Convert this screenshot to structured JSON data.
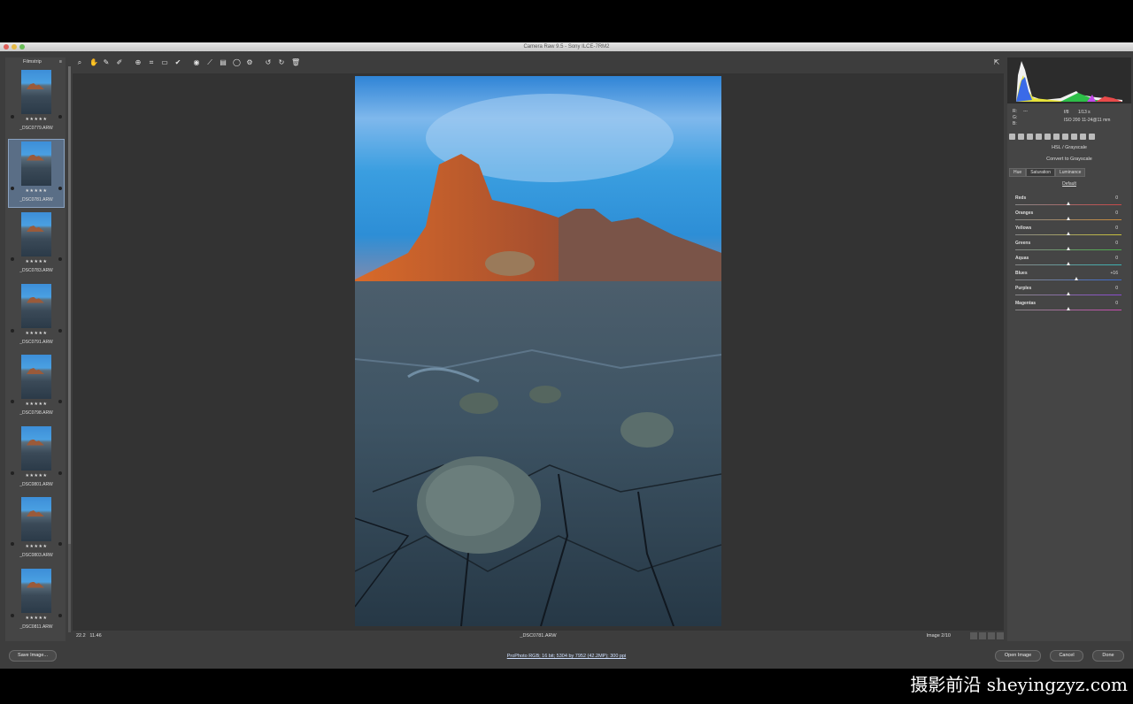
{
  "app": {
    "title": "Camera Raw 9.5 - Sony ILCE-7RM2"
  },
  "filmstrip": {
    "header": "Filmstrip",
    "menu_icon": "≡",
    "items": [
      {
        "name": "_DSC0779.ARW",
        "stars": "★★★★★"
      },
      {
        "name": "_DSC0781.ARW",
        "stars": "★★★★★"
      },
      {
        "name": "_DSC0783.ARW",
        "stars": "★★★★★"
      },
      {
        "name": "_DSC0791.ARW",
        "stars": "★★★★★"
      },
      {
        "name": "_DSC0798.ARW",
        "stars": "★★★★★"
      },
      {
        "name": "_DSC0801.ARW",
        "stars": "★★★★★"
      },
      {
        "name": "_DSC0803.ARW",
        "stars": "★★★★★"
      },
      {
        "name": "_DSC0811.ARW",
        "stars": "★★★★★"
      }
    ],
    "selected_index": 1
  },
  "toolbar": {
    "tools": [
      "zoom-icon",
      "hand-icon",
      "white-balance-icon",
      "color-sampler-icon",
      "targeted-adjust-icon",
      "crop-icon",
      "straighten-icon",
      "spot-removal-icon",
      "red-eye-icon",
      "adjustment-brush-icon",
      "graduated-filter-icon",
      "radial-filter-icon",
      "preferences-icon",
      "rotate-ccw-icon",
      "rotate-cw-icon",
      "trash-icon"
    ],
    "fullscreen_icon": "fullscreen-icon"
  },
  "status": {
    "zoom": "22.2",
    "zoom2": "11.46",
    "filename": "_DSC0781.ARW",
    "image_counter": "Image 2/10"
  },
  "panel": {
    "camera_info": {
      "rgb": [
        "R:",
        "G:",
        "B:"
      ],
      "dashes": "---",
      "aperture": "f/8",
      "shutter": "1/13 s",
      "iso": "ISO 200",
      "lens": "11-24@11 mm"
    },
    "title": "HSL / Grayscale",
    "convert_label": "Convert to Grayscale",
    "subtabs": [
      "Hue",
      "Saturation",
      "Luminance"
    ],
    "active_subtab": "Saturation",
    "default_label": "Default",
    "sliders": [
      {
        "label": "Reds",
        "value": "0",
        "pos": 0.5,
        "color": "#c84848"
      },
      {
        "label": "Oranges",
        "value": "0",
        "pos": 0.5,
        "color": "#c98a3a"
      },
      {
        "label": "Yellows",
        "value": "0",
        "pos": 0.5,
        "color": "#c9c13a"
      },
      {
        "label": "Greens",
        "value": "0",
        "pos": 0.5,
        "color": "#4aae4a"
      },
      {
        "label": "Aquas",
        "value": "0",
        "pos": 0.5,
        "color": "#3ab2b2"
      },
      {
        "label": "Blues",
        "value": "+16",
        "pos": 0.58,
        "color": "#3a6ad0"
      },
      {
        "label": "Purples",
        "value": "0",
        "pos": 0.5,
        "color": "#8a4ad0"
      },
      {
        "label": "Magentas",
        "value": "0",
        "pos": 0.5,
        "color": "#c84ab0"
      }
    ]
  },
  "bottom": {
    "save_label": "Save Image...",
    "workflow": "ProPhoto RGB; 16 bit; 5304 by 7952 (42.2MP); 300 ppi",
    "open_label": "Open Image",
    "cancel_label": "Cancel",
    "done_label": "Done"
  },
  "watermark": "摄影前沿 sheyingzyz.com"
}
